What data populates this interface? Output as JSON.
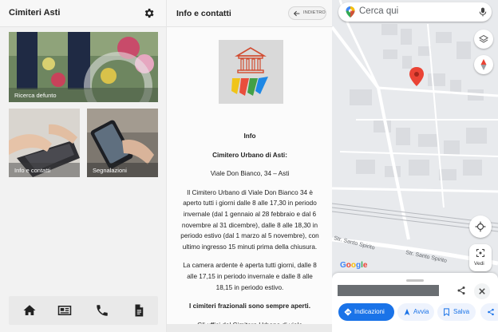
{
  "panel_home": {
    "title": "Cimiteri Asti",
    "tiles": [
      {
        "label": "Ricerca defunto"
      },
      {
        "label": "Info e contatti"
      },
      {
        "label": "Segnalazioni"
      }
    ],
    "nav_icons": [
      "home-icon",
      "news-icon",
      "phone-icon",
      "document-icon"
    ]
  },
  "panel_info": {
    "title": "Info e contatti",
    "back_label": "INDIETRO",
    "heading": "Info",
    "cemetery_name": "Cimitero Urbano di Asti:",
    "address": "Viale Don Bianco, 34 – Asti",
    "hours": "Il Cimitero Urbano di Viale Don Bianco 34 è aperto tutti i giorni dalle 8 alle 17,30 in periodo invernale (dal 1 gennaio al 28 febbraio e dal 6 novembre al 31 dicembre), dalle 8 alle 18,30 in periodo estivo (dal 1 marzo al 5 novembre), con ultimo ingresso 15 minuti prima della chiusura.",
    "camera_ardente": "La camera ardente è aperta tutti giorni, dalle 8 alle 17,15 in periodo invernale e dalle 8 alle 18,15 in periodo estivo.",
    "frazionali": "I cimiteri frazionali sono sempre aperti.",
    "uffici": "Gli uffici del Cimitero Urbano di viale"
  },
  "panel_map": {
    "search_placeholder": "Cerca qui",
    "street_labels": [
      "Str. Santo Spirito",
      "Str. Santo Spirito"
    ],
    "vedi_label": "Vedi",
    "google_logo": "Google",
    "actions": [
      {
        "label": "Indicazioni"
      },
      {
        "label": "Avvia"
      },
      {
        "label": "Salva"
      }
    ]
  },
  "colors": {
    "map_pin": "#ea4335",
    "action_primary": "#1a73e8",
    "action_text": "#1a73e8",
    "topbar": "#f7f7f7"
  }
}
